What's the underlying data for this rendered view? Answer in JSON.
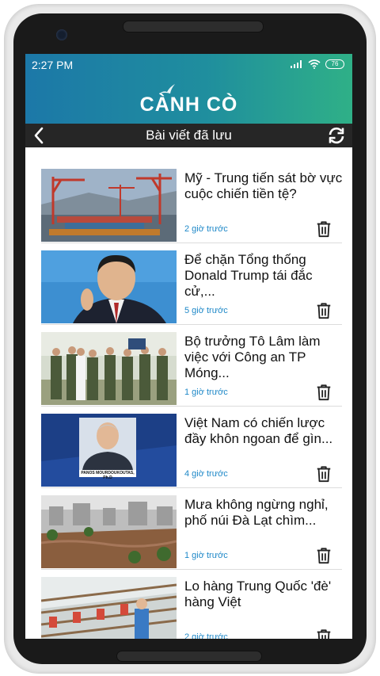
{
  "status_bar": {
    "time": "2:27 PM",
    "battery": "76"
  },
  "header": {
    "logo": "CÀNH CÒ"
  },
  "toolbar": {
    "title": "Bài viết đã lưu"
  },
  "articles": [
    {
      "title": "Mỹ - Trung tiến sát bờ vực cuộc chiến tiền tệ?",
      "time": "2 giờ trước"
    },
    {
      "title": "Để chặn Tổng thống Donald Trump tái đắc cử,...",
      "time": "5 giờ trước"
    },
    {
      "title": "Bộ trưởng Tô Lâm làm việc với Công an TP Móng...",
      "time": "1 giờ trước"
    },
    {
      "title": "Việt Nam có chiến lược đầy khôn ngoan để gìn...",
      "time": "4 giờ trước",
      "image_caption": "PANOS MOURDOUKOUTAS, Ph.D"
    },
    {
      "title": "Mưa không ngừng nghỉ, phố núi Đà Lạt chìm...",
      "time": "1 giờ trước"
    },
    {
      "title": "Lo hàng Trung Quốc 'đè' hàng Việt",
      "time": "2 giờ trước"
    }
  ],
  "colors": {
    "header_start": "#1c78a8",
    "header_end": "#2fb087",
    "toolbar": "#262626",
    "time_text": "#1e88c8"
  }
}
